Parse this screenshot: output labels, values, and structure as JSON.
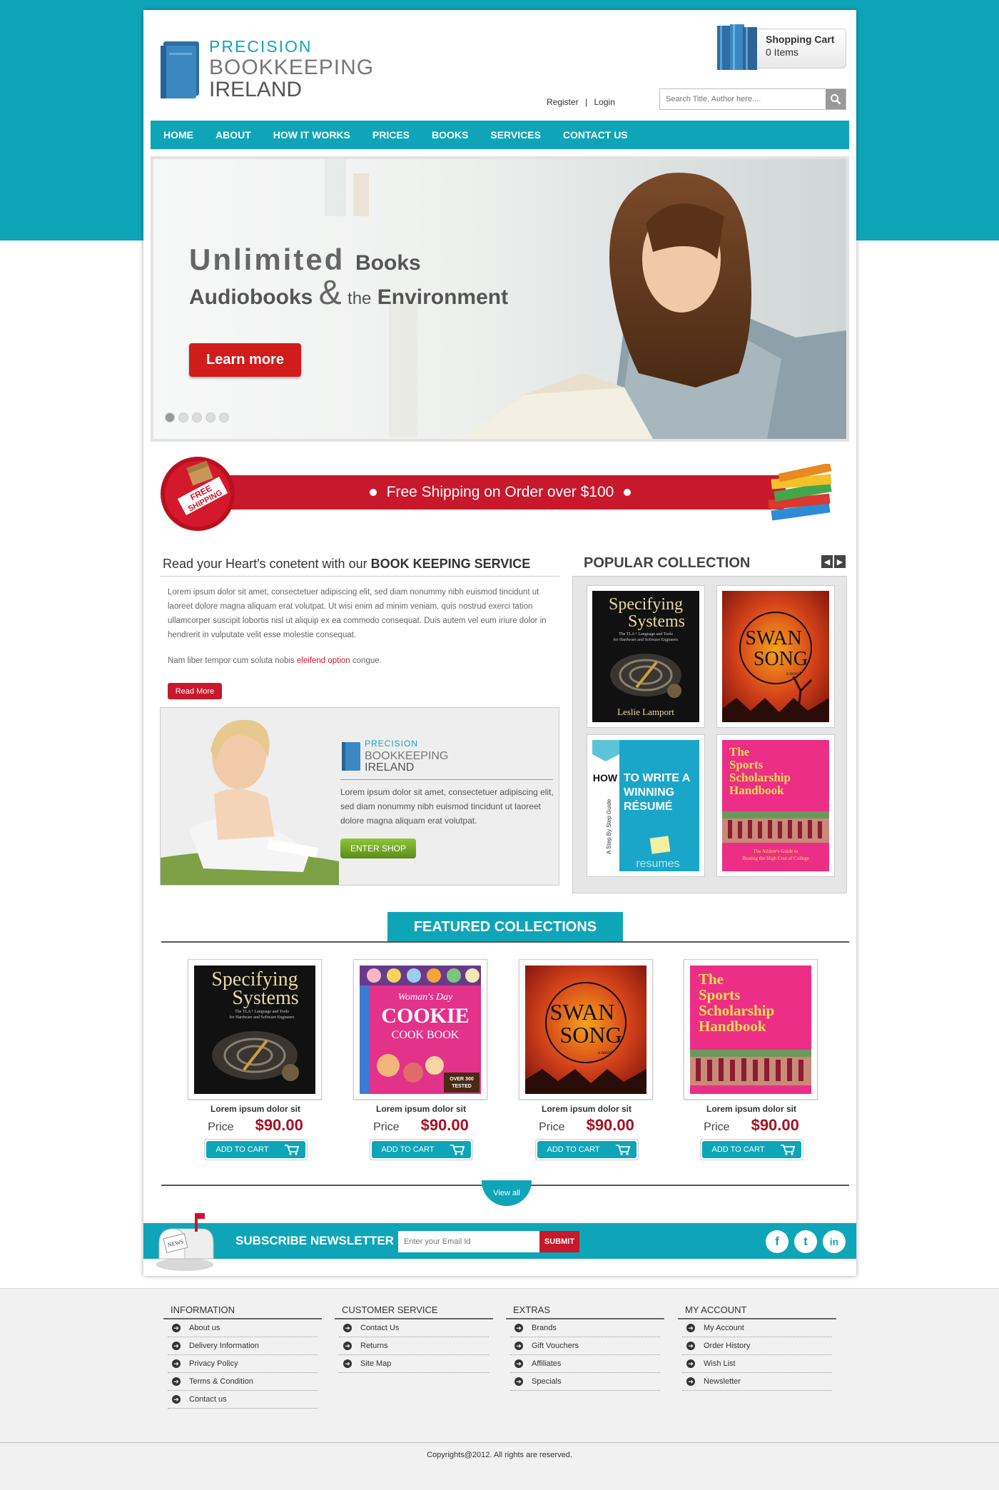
{
  "brand": {
    "line1": "PRECISION",
    "line2": "BOOKKEEPING",
    "line3": "IRELAND"
  },
  "cart": {
    "title": "Shopping Cart",
    "count": "0 Items"
  },
  "auth": {
    "register": "Register",
    "separator": "|",
    "login": "Login"
  },
  "search": {
    "placeholder": "Search Title, Author here...."
  },
  "nav": [
    "HOME",
    "ABOUT",
    "HOW IT WORKS",
    "PRICES",
    "BOOKS",
    "SERVICES",
    "CONTACT US"
  ],
  "hero": {
    "word1": "Unlimited",
    "word2": "Books",
    "word3": "Audiobooks",
    "amp": "&",
    "the": "the",
    "word4": "Environment",
    "button": "Learn more",
    "slides": 5,
    "active_slide": 1
  },
  "shipping": {
    "text": "Free Shipping on Order over $100",
    "badge_line1": "FREE",
    "badge_line2": "SHIPPING"
  },
  "service": {
    "title_prefix": "Read your Heart's conetent with our ",
    "title_bold": "BOOK KEEPING SERVICE",
    "para1": "Lorem ipsum dolor sit amet, consectetuer adipiscing elit, sed diam nonummy nibh euismod tincidunt ut laoreet dolore magna aliquam erat volutpat. Ut wisi enim ad minim veniam, quis nostrud exerci tation ullamcorper suscipit lobortis nisl ut aliquip ex ea commodo consequat. Duis autem vel eum iriure dolor in hendrerit in vulputate velit esse molestie consequat.",
    "para2_before": "Nam liber tempor cum soluta nobis ",
    "para2_link": "eleifend option",
    "para2_after": " congue.",
    "button": "Read More"
  },
  "promo": {
    "text": "Lorem ipsum dolor sit amet, consectetuer adipiscing elit, sed diam nonummy nibh euismod tincidunt ut laoreet dolore magna aliquam erat volutpat.",
    "button": "ENTER SHOP"
  },
  "popular": {
    "title": "POPULAR COLLECTION",
    "prev": "◀",
    "next": "▶"
  },
  "covers": {
    "spec_l1": "Specifying",
    "spec_l2": "Systems",
    "spec_sub1": "The TLA+ Language and Tools",
    "spec_sub2": "for Hardware and Software Engineers",
    "spec_author": "Leslie Lamport",
    "swan_l1": "SWAN",
    "swan_l2": "SONG",
    "swan_sub": "a novel",
    "resume_side": "A Step By Step Guide",
    "resume_how": "HOW",
    "resume_l1": "TO WRITE A",
    "resume_l2": "WINNING",
    "resume_l3": "RÉSUMÉ",
    "resume_brand": "resumes",
    "sport_l1": "The",
    "sport_l2": "Sports",
    "sport_l3": "Scholarship",
    "sport_l4": "Handbook",
    "sport_sub1": "The Athlete's Guide to",
    "sport_sub2": "Beating the High Cost of College",
    "cookie_l1": "Woman's Day",
    "cookie_l2": "COOKIE",
    "cookie_l3": "COOK BOOK",
    "cookie_badge1": "OVER 300",
    "cookie_badge2": "TESTED"
  },
  "featured": {
    "title": "FEATURED COLLECTIONS",
    "products": [
      {
        "name": "Lorem ipsum dolor sit",
        "price_label": "Price",
        "price": "$90.00",
        "button": "ADD TO CART"
      },
      {
        "name": "Lorem ipsum dolor sit",
        "price_label": "Price",
        "price": "$90.00",
        "button": "ADD TO CART"
      },
      {
        "name": "Lorem ipsum dolor sit",
        "price_label": "Price",
        "price": "$90.00",
        "button": "ADD TO CART"
      },
      {
        "name": "Lorem ipsum dolor sit",
        "price_label": "Price",
        "price": "$90.00",
        "button": "ADD TO CART"
      }
    ],
    "view_all": "View all"
  },
  "newsletter": {
    "title": "SUBSCRIBE NEWSLETTER",
    "placeholder": "Enter your Email Id",
    "button": "SUBMIT",
    "mailbox_label": "NEWS"
  },
  "social": {
    "facebook": "f",
    "twitter": "t",
    "linkedin": "in"
  },
  "footer": {
    "columns": [
      {
        "title": "INFORMATION",
        "items": [
          "About us",
          "Delivery Information",
          "Privacy Policy",
          "Terms & Condition",
          "Contact us"
        ]
      },
      {
        "title": "CUSTOMER SERVICE",
        "items": [
          "Contact Us",
          "Returns",
          "Site Map"
        ]
      },
      {
        "title": "EXTRAS",
        "items": [
          "Brands",
          "Gift Vouchers",
          "Affiliates",
          "Specials"
        ]
      },
      {
        "title": "MY ACCOUNT",
        "items": [
          "My Account",
          "Order History",
          "Wish List",
          "Newsletter"
        ]
      }
    ],
    "copyright": "Copyrights@2012. All rights are reserved."
  },
  "colors": {
    "teal": "#0fa5b8",
    "red": "#c8182c",
    "price_red": "#a31224",
    "green": "#6fa523"
  }
}
